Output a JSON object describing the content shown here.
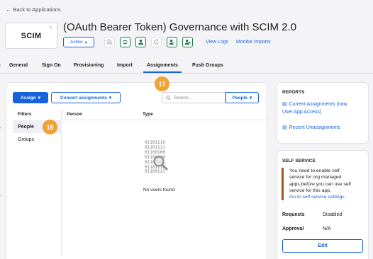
{
  "back_link": "Back to Applications",
  "app": {
    "logo_text": "SCIM",
    "title": "(OAuth Bearer Token) Governance with SCIM 2.0",
    "status": "Active",
    "view_logs": "View Logs",
    "monitor_imports": "Monitor Imports"
  },
  "tabs": [
    "General",
    "Sign On",
    "Provisioning",
    "Import",
    "Assignments",
    "Push Groups"
  ],
  "toolbar": {
    "assign": "Assign",
    "convert": "Convert assignments",
    "search_placeholder": "Search...",
    "people_filter": "People"
  },
  "badges": {
    "search": "17",
    "people": "18"
  },
  "filters": {
    "heading": "Filters",
    "items": [
      "People",
      "Groups"
    ]
  },
  "table": {
    "columns": [
      "Person",
      "Type"
    ],
    "binary_art": "01101110\n01101111\n01100100\n01100100\n01100001\n01101110\n01100111",
    "empty_message": "No users found"
  },
  "reports": {
    "heading": "REPORTS",
    "links": [
      "Current Assignments (now",
      "User App Access)",
      "Recent Unassignments"
    ]
  },
  "self_service": {
    "heading": "SELF SERVICE",
    "note_lines": [
      "You need to enable self",
      "service for org managed",
      "apps before you can use self",
      "service for this app."
    ],
    "note_link": "Go to self service settings",
    "requests_label": "Requests",
    "requests_value": "Disabled",
    "approval_label": "Approval",
    "approval_value": "N/A",
    "edit": "Edit"
  },
  "colors": {
    "accent": "#1662dd",
    "badge": "#f0a236",
    "green": "#1e7b4c"
  }
}
